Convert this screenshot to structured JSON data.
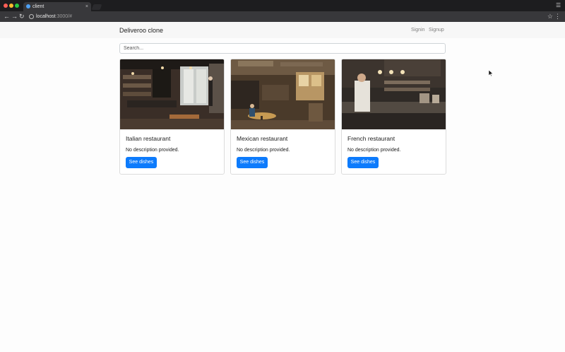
{
  "browser": {
    "tab_title": "client",
    "tab_close": "×",
    "url_host": "localhost",
    "url_port": ":3000/#",
    "icons": {
      "back": "arrow-left-icon",
      "forward": "arrow-right-icon",
      "reload": "reload-icon",
      "info": "info-icon",
      "star": "star-icon",
      "menu": "kebab-menu-icon",
      "profile": "profile-icon"
    },
    "colors": {
      "titlebar": "#1d1d1f",
      "toolbar": "#38383b"
    }
  },
  "navbar": {
    "brand": "Deliveroo clone",
    "links": [
      "Signin",
      "Signup"
    ]
  },
  "search": {
    "placeholder": "Search..."
  },
  "restaurants": [
    {
      "title": "Italian restaurant",
      "description": "No description provided.",
      "button": "See dishes",
      "image": "italian-restaurant-interior-photo"
    },
    {
      "title": "Mexican restaurant",
      "description": "No description provided.",
      "button": "See dishes",
      "image": "mexican-restaurant-interior-photo"
    },
    {
      "title": "French restaurant",
      "description": "No description provided.",
      "button": "See dishes",
      "image": "french-restaurant-kitchen-photo"
    }
  ],
  "colors": {
    "primary_button": "#0d7bfc",
    "navbar_bg": "#f7f7f7"
  }
}
